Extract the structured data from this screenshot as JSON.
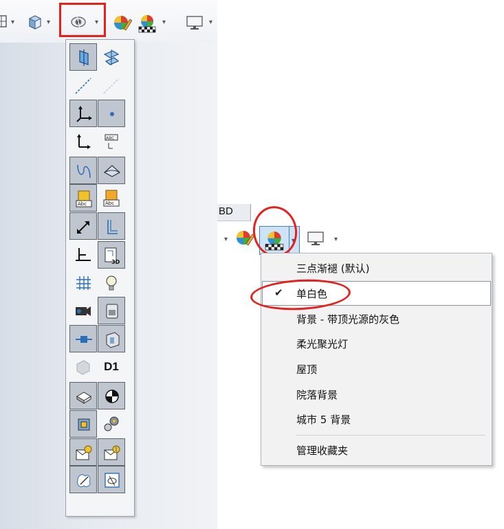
{
  "left_toolbar": {
    "highlight_color": "#e4211d",
    "icons": [
      "grid-icon",
      "cube-view-icon",
      "hide-show-eye-icon",
      "appearance-edit-icon",
      "scene-icon",
      "display-monitor-icon"
    ]
  },
  "flyout": {
    "items": [
      "plane-icon",
      "plane-3d-icon",
      "axis-icon",
      "temporary-axis-icon",
      "origin-icon",
      "point-icon",
      "coordinate-system-icon",
      "dimension-xpert-icon",
      "curves-icon",
      "surface-icon",
      "annotation-abc-icon",
      "annotation-abc-2-icon",
      "weld-bead-icon",
      "sketch-relations-icon",
      "plane-sketch-icon",
      "sketch-3d-icon",
      "grid-icon",
      "lights-icon",
      "camera-icon",
      "decal-icon",
      "connector-icon",
      "routing-icon",
      "hole-wizard-icon",
      "dimension-names-icon",
      "printer-icon",
      "center-of-mass-icon",
      "parts-icon",
      "gear-mate-icon",
      "sensors-icon",
      "sensors-2-icon",
      "sketch-edit-icon",
      "display-pane-icon"
    ],
    "d1_label": "D1"
  },
  "right_toolbar": {
    "tab_label": "BD",
    "icons": [
      "appearance-edit-icon",
      "scene-icon",
      "display-monitor-icon"
    ]
  },
  "scene_menu": {
    "items": [
      {
        "label": "三点渐褪 (默认)",
        "checked": false
      },
      {
        "label": "单白色",
        "checked": true
      },
      {
        "label": "背景 - 带顶光源的灰色",
        "checked": false
      },
      {
        "label": "柔光聚光灯",
        "checked": false
      },
      {
        "label": "屋顶",
        "checked": false
      },
      {
        "label": "院落背景",
        "checked": false
      },
      {
        "label": "城市 5 背景",
        "checked": false
      },
      {
        "label": "管理收藏夹",
        "checked": false
      }
    ],
    "check_glyph": "✔"
  }
}
